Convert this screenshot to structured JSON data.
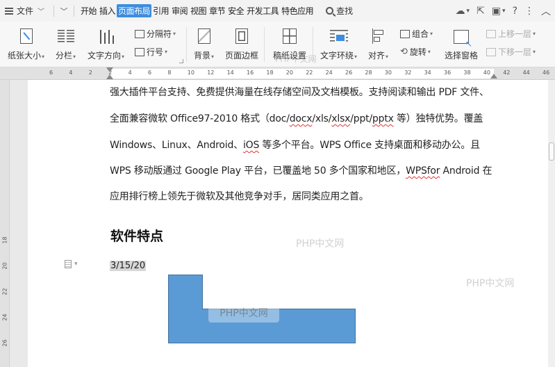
{
  "menubar": {
    "file_label": "文件",
    "tabs": [
      {
        "label": "开始",
        "active": false
      },
      {
        "label": "插入",
        "active": false
      },
      {
        "label": "页面布局",
        "active": true
      },
      {
        "label": "引用",
        "active": false
      },
      {
        "label": "审阅",
        "active": false
      },
      {
        "label": "视图",
        "active": false
      },
      {
        "label": "章节",
        "active": false
      },
      {
        "label": "安全",
        "active": false
      },
      {
        "label": "开发工具",
        "active": false
      },
      {
        "label": "特色应用",
        "active": false
      }
    ],
    "search_label": "查找",
    "icons": [
      "cloud-sync-icon",
      "share-icon",
      "inbox-icon",
      "help-icon",
      "more-icon",
      "collapse-icon"
    ]
  },
  "ribbon": {
    "paper_size": "纸张大小",
    "columns": "分栏",
    "text_direction": "文字方向",
    "separator": "分隔符",
    "line_numbers": "行号",
    "background": "背景",
    "page_border": "页面边框",
    "manuscript": "稿纸设置",
    "text_wrap": "文字环绕",
    "align": "对齐",
    "group": "组合",
    "rotate": "旋转",
    "selection_pane": "选择窗格",
    "bring_forward": "上移一层",
    "send_backward": "下移一层"
  },
  "ruler": {
    "ticks": [
      "6",
      "4",
      "2",
      "2",
      "4",
      "6",
      "8",
      "10",
      "12",
      "14",
      "16",
      "18",
      "20",
      "22",
      "24",
      "26",
      "28",
      "30",
      "32",
      "34",
      "36",
      "38",
      "40",
      "42",
      "44",
      "46"
    ]
  },
  "vruler": {
    "ticks": [
      "18",
      "20",
      "22",
      "24",
      "26"
    ]
  },
  "document": {
    "lines": [
      "强大插件平台支持、免费提供海量在线存储空间及文档模板。支持阅读和输出 PDF 文件、",
      "全面兼容微软 Office97-2010 格式（doc/docx/xls/xlsx/ppt/pptx 等）独特优势。覆盖",
      "Windows、Linux、Android、iOS 等多个平台。WPS Office 支持桌面和移动办公。且",
      "WPS 移动版通过 Google Play 平台，已覆盖地 50 多个国家和地区，WPSfor Android 在",
      "应用排行榜上领先于微软及其他竞争对手，居同类应用之首。"
    ],
    "heading": "软件特点",
    "date": "3/15/20"
  },
  "watermark": "PHP中文网",
  "colors": {
    "accent": "#3c8dde",
    "shape_fill": "#5b9bd5",
    "shape_border": "#41719c"
  }
}
